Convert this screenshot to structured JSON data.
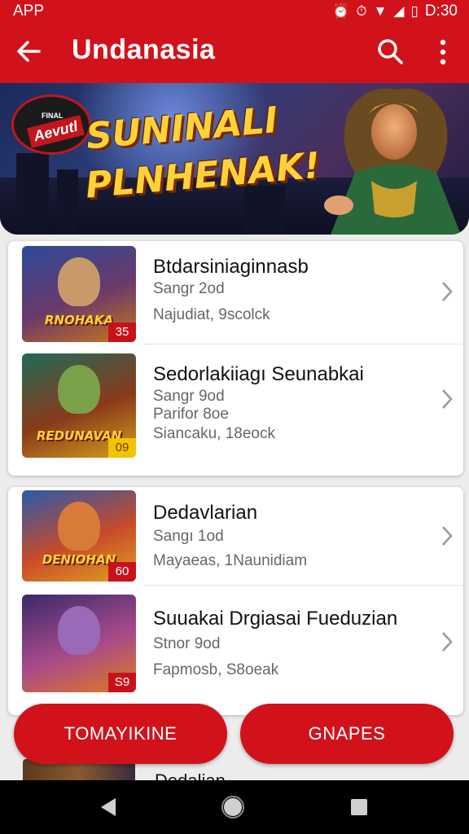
{
  "status_bar": {
    "app_label": "APP",
    "time": "D:30"
  },
  "app_bar": {
    "title": "Undanasia"
  },
  "banner": {
    "badge_small": "FINAL",
    "badge": "Aevutl",
    "headline_line1": "SUNINALI",
    "headline_line2": "PLNHENAK!"
  },
  "groups": [
    {
      "items": [
        {
          "title": "Btdarsiniaginnasb",
          "line1": "Sangr 2od",
          "line2": "Najudiat, 9scolck",
          "thumb_logo": "RNOHAKA",
          "tag": "35",
          "tag_style": "red",
          "palette": [
            "#2d4a9a",
            "#6a3a6a",
            "#c8761a"
          ]
        },
        {
          "title": "Sedorlakiiagı Seunabkai",
          "line1": "Sangr 9od",
          "line2": "Parifor 8oe",
          "line3": "Siancaku, 18eock",
          "thumb_logo": "REDUNAVAN",
          "tag": "09",
          "tag_style": "yellow",
          "palette": [
            "#1f6a5a",
            "#8a3a1a",
            "#d2a020"
          ]
        }
      ]
    },
    {
      "items": [
        {
          "title": "Dedavlarian",
          "line1": "Sangı 1od",
          "line2": "Mayaeas, 1Naunidiam",
          "thumb_logo": "DENIOHAN",
          "tag": "60",
          "tag_style": "red",
          "palette": [
            "#2a5aaa",
            "#c84a2a",
            "#e0a020"
          ]
        },
        {
          "title": "Suuakai Drgiasai Fueduzian",
          "line1": "Stnor 9od",
          "line2": "Fapmosb, S8oeak",
          "thumb_logo": "",
          "tag": "S9",
          "tag_style": "red",
          "palette": [
            "#3a2a6a",
            "#a84a8a",
            "#e07a20"
          ]
        }
      ]
    }
  ],
  "buttons": {
    "primary": "TOMAYIKINE",
    "secondary": "GNAPES"
  },
  "peek_text": "Dedalian"
}
